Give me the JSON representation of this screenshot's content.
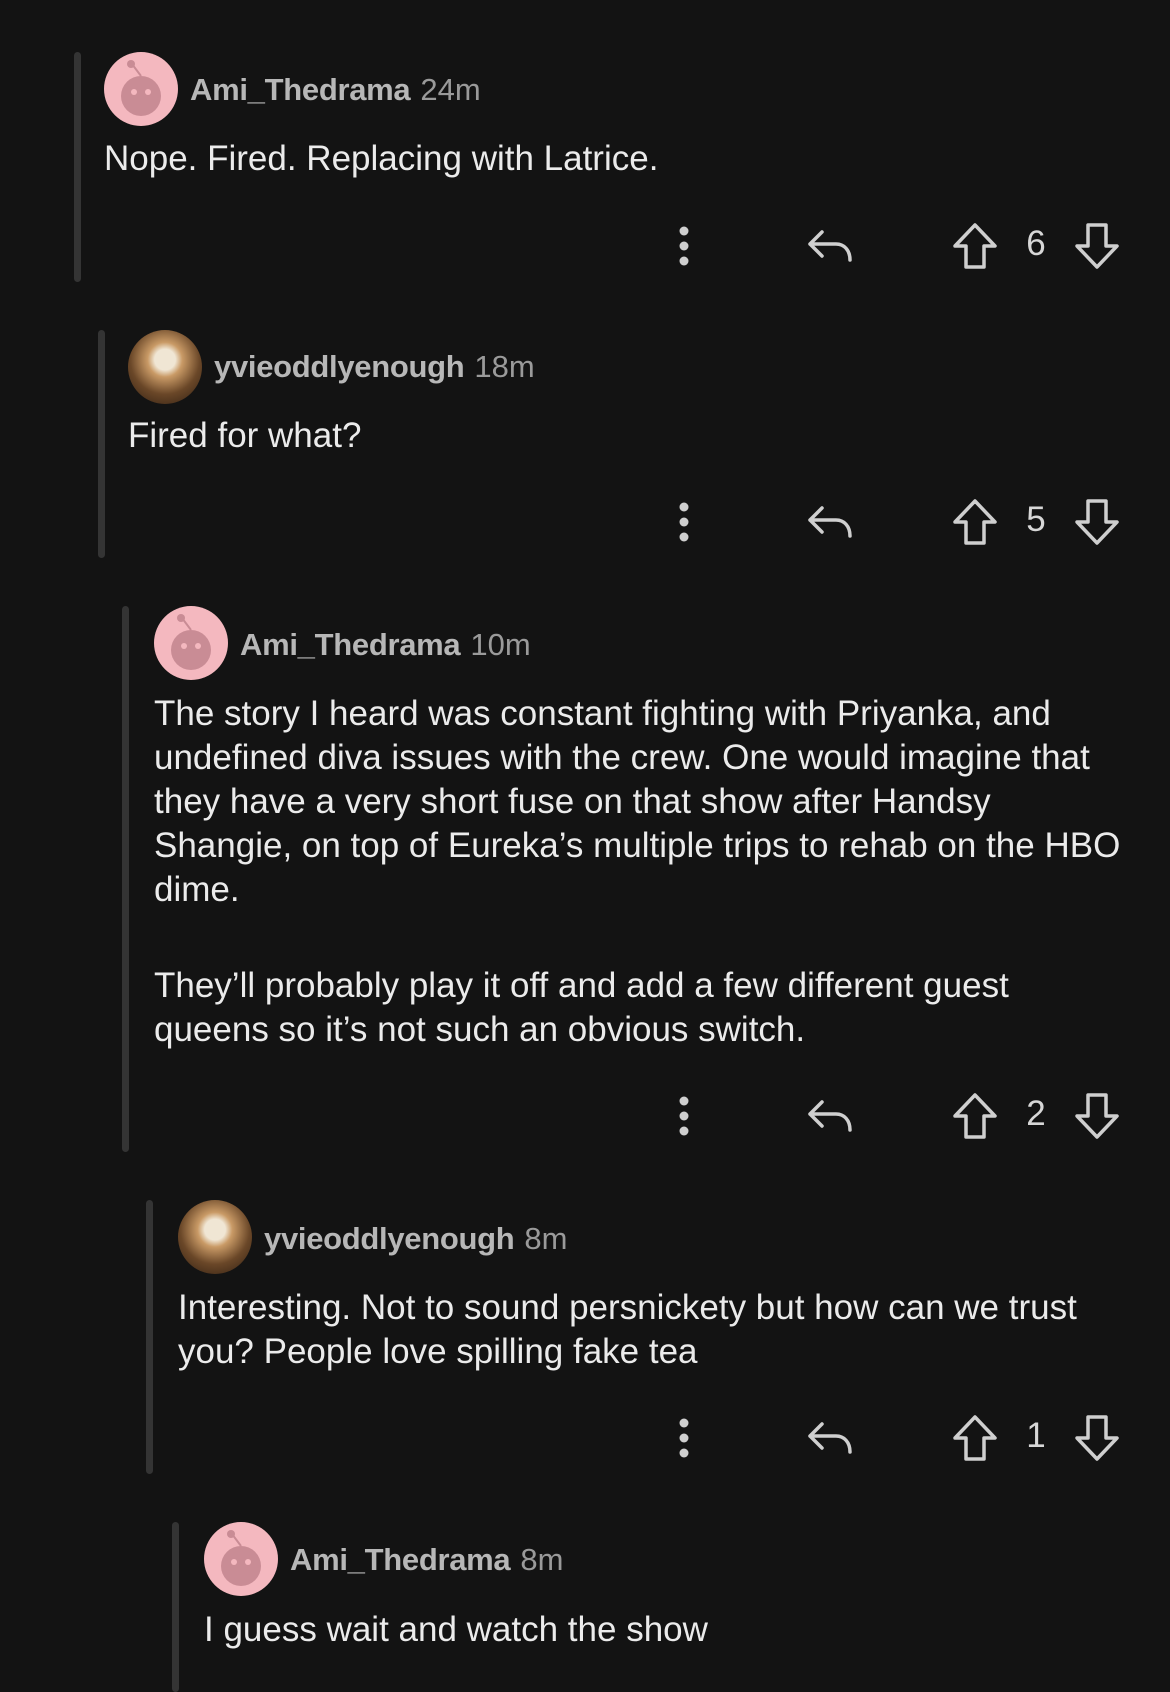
{
  "comments": [
    {
      "author": "Ami_Thedrama",
      "age": "24m",
      "body": [
        "Nope. Fired. Replacing with Latrice."
      ],
      "score": "6",
      "avatar": "snoo-avatar"
    },
    {
      "author": "yvieoddlyenough",
      "age": "18m",
      "body": [
        "Fired for what?"
      ],
      "score": "5",
      "avatar": "profile-photo-avatar"
    },
    {
      "author": "Ami_Thedrama",
      "age": "10m",
      "body": [
        "The story I heard was constant fighting with Priyanka, and undefined diva issues with the crew. One would imagine that they have a very short fuse on that show after Handsy Shangie, on top of Eureka’s multiple trips to rehab on the HBO dime.",
        "They’ll probably play it off and add a few different guest queens so it’s not such an obvious switch."
      ],
      "score": "2",
      "avatar": "snoo-avatar"
    },
    {
      "author": "yvieoddlyenough",
      "age": "8m",
      "body": [
        "Interesting. Not to sound persnickety but how can we trust you? People love spilling fake tea"
      ],
      "score": "1",
      "avatar": "profile-photo-avatar"
    },
    {
      "author": "Ami_Thedrama",
      "age": "8m",
      "body": [
        "I guess wait and watch the show"
      ],
      "avatar": "snoo-avatar"
    }
  ],
  "icons": {
    "more": "more-options-icon",
    "reply": "reply-arrow-icon",
    "upvote": "upvote-arrow-icon",
    "downvote": "downvote-arrow-icon"
  },
  "colors": {
    "background": "#131313",
    "thread_line": "#343434",
    "snoo_avatar_bg": "#f4b8bf"
  }
}
